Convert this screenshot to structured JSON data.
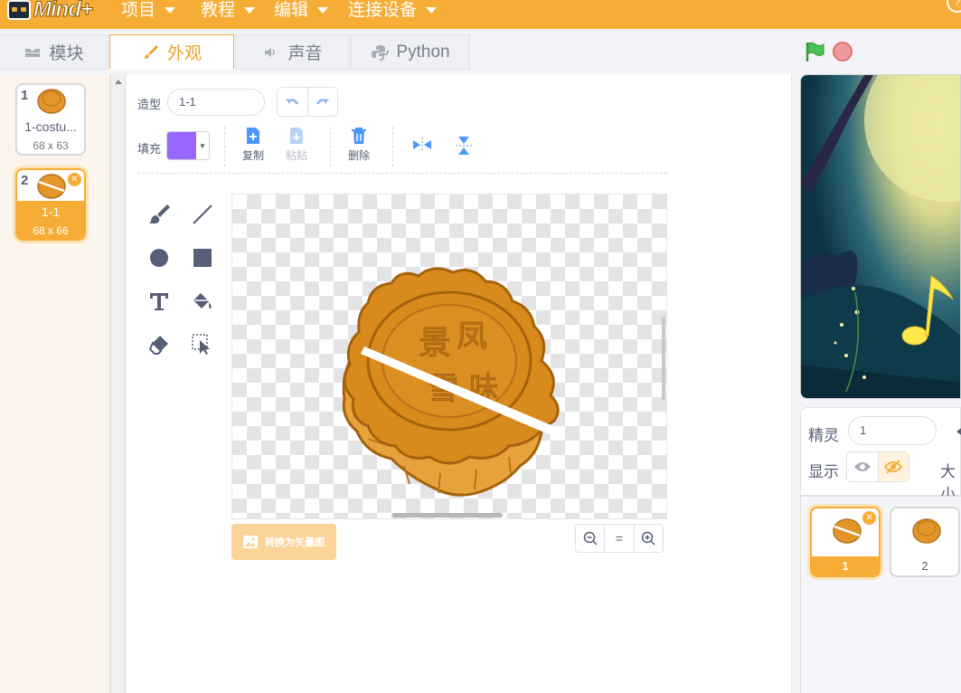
{
  "app": {
    "logo_text": "Mind+",
    "menu": [
      "项目",
      "教程",
      "编辑",
      "连接设备"
    ],
    "help_label": "?"
  },
  "tabs": [
    {
      "label": "模块",
      "icon": "blocks-icon",
      "active": false
    },
    {
      "label": "外观",
      "icon": "brush-icon",
      "active": true
    },
    {
      "label": "声音",
      "icon": "speaker-icon",
      "active": false
    },
    {
      "label": "Python",
      "icon": "python-icon",
      "active": false
    }
  ],
  "costumes": [
    {
      "number": "1",
      "name": "1-costu...",
      "size": "68 x 63",
      "selected": false
    },
    {
      "number": "2",
      "name": "1-1",
      "size": "68 x 66",
      "selected": true
    }
  ],
  "editor": {
    "costume_label": "造型",
    "costume_name": "1-1",
    "fill_label": "填充",
    "fill_color": "#9966ff",
    "copy_label": "复制",
    "paste_label": "粘贴",
    "delete_label": "删除",
    "convert_label": "转换为矢量图",
    "zoom_reset": "="
  },
  "stage_info": {
    "sprite_label": "精灵",
    "sprite_name": "1",
    "show_label": "显示",
    "size_label": "大小"
  },
  "sprites": [
    {
      "label": "1",
      "selected": true
    },
    {
      "label": "2",
      "selected": false
    }
  ],
  "colors": {
    "accent": "#f6ad36",
    "mooncake": "#d98a1c",
    "fill": "#9966ff"
  }
}
